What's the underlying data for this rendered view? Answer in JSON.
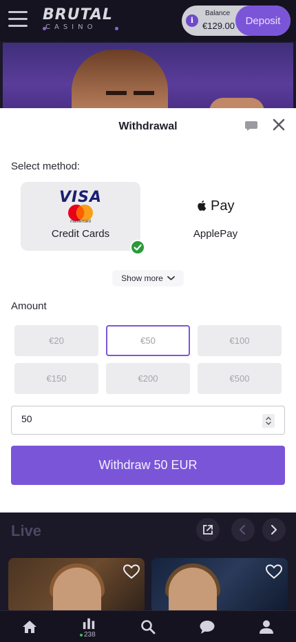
{
  "header": {
    "logo_main": "BRUTAL",
    "logo_sub": "CASINO",
    "balance_label": "Balance",
    "balance_value": "€129.00",
    "deposit_label": "Deposit"
  },
  "modal": {
    "title": "Withdrawal",
    "select_method_label": "Select method:",
    "methods": [
      {
        "name": "Credit Cards",
        "brand_text": "VISA",
        "sub_brand": "mastercard",
        "selected": true
      },
      {
        "name": "ApplePay",
        "brand_text": "Pay",
        "selected": false
      }
    ],
    "show_more_label": "Show more",
    "amount_label": "Amount",
    "amount_options": [
      "€20",
      "€50",
      "€100",
      "€150",
      "€200",
      "€500"
    ],
    "selected_amount_index": 1,
    "amount_input_value": "50",
    "withdraw_button_label": "Withdraw 50 EUR"
  },
  "live": {
    "title": "Live"
  },
  "bottom_nav": {
    "online_count": "238"
  },
  "colors": {
    "accent": "#7b55d8",
    "success": "#2a9a3a",
    "background": "#1b1828"
  }
}
